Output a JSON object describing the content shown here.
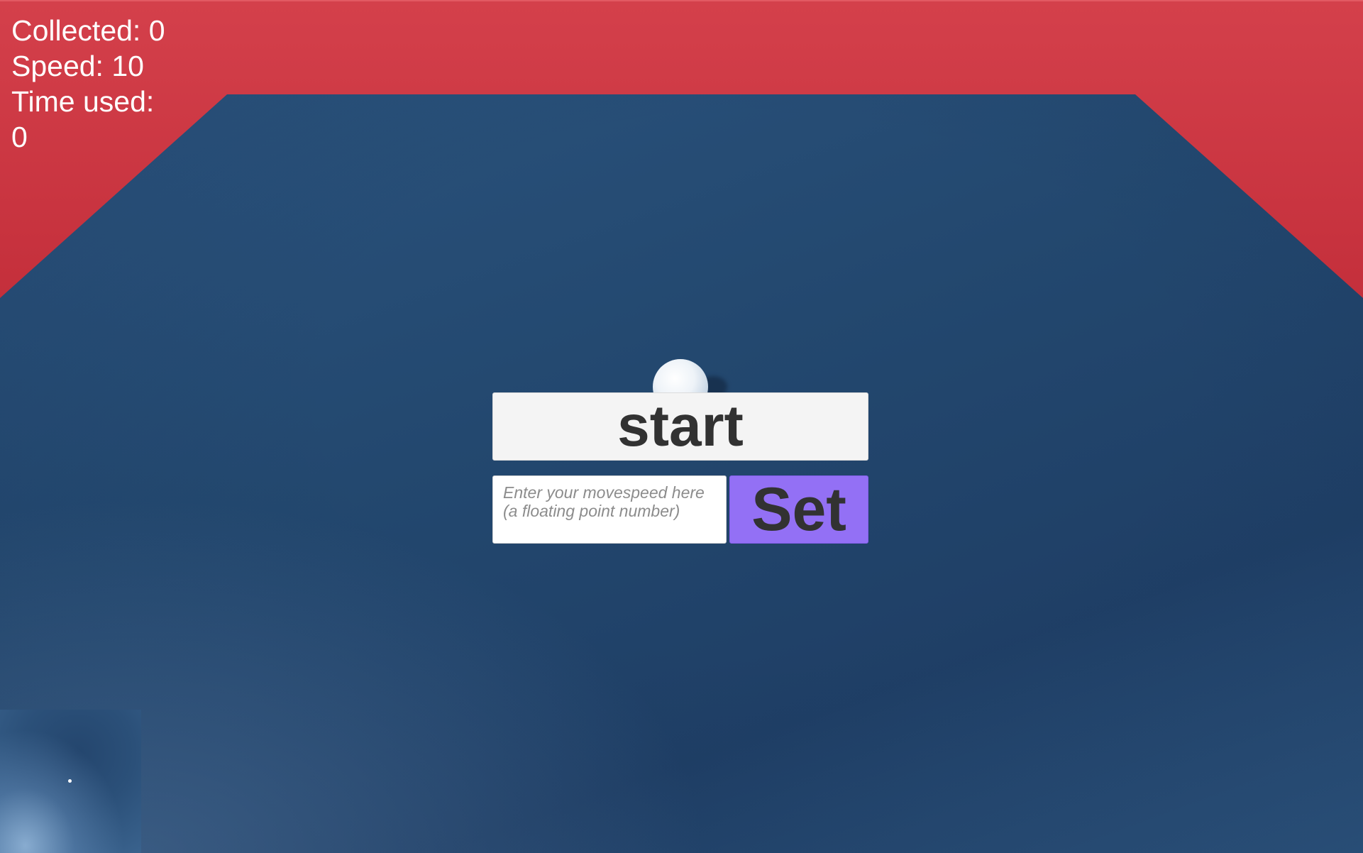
{
  "hud": {
    "collected": "Collected: 0",
    "speed": "Speed: 10",
    "time_label": "Time used:",
    "time_value": "0"
  },
  "controls": {
    "start_label": "start",
    "speed_input_placeholder": "Enter your movespeed here (a floating point number)",
    "speed_input_value": "",
    "set_label": "Set"
  },
  "colors": {
    "wall": "#cf3440",
    "floor": "#24486f",
    "start_button_bg": "#f4f4f4",
    "set_button_bg": "#9370f5",
    "button_text": "#323232",
    "hud_text": "#ffffff"
  },
  "icons": {
    "player": "white-sphere",
    "minimap_marker": "white-dot"
  }
}
